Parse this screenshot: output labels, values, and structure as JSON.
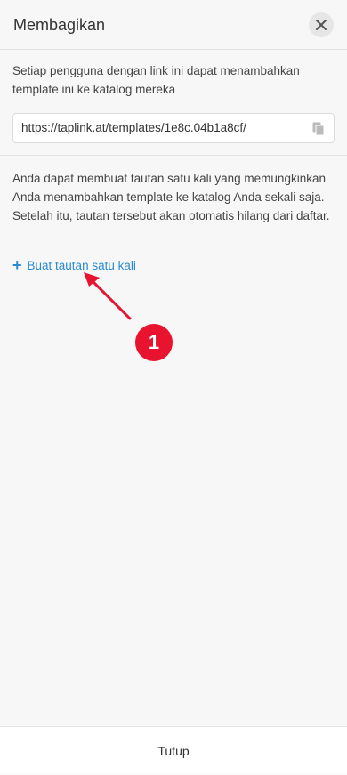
{
  "header": {
    "title": "Membagikan",
    "close_icon": "close-icon"
  },
  "share": {
    "description": "Setiap pengguna dengan link ini dapat menambahkan template ini ke katalog mereka",
    "url": "https://taplink.at/templates/1e8c.04b1a8cf/",
    "copy_icon": "copy-icon"
  },
  "one_time": {
    "info": "Anda dapat membuat tautan satu kali yang memungkinkan Anda menambahkan template ke katalog Anda sekali saja. Setelah itu, tautan tersebut akan otomatis hilang dari daftar.",
    "create_label": "Buat tautan satu kali",
    "plus_icon": "plus-icon"
  },
  "annotation": {
    "badge_number": "1",
    "color": "#e8132e"
  },
  "footer": {
    "close_label": "Tutup"
  },
  "colors": {
    "link": "#2a8ad3",
    "background": "#f7f7f7"
  }
}
